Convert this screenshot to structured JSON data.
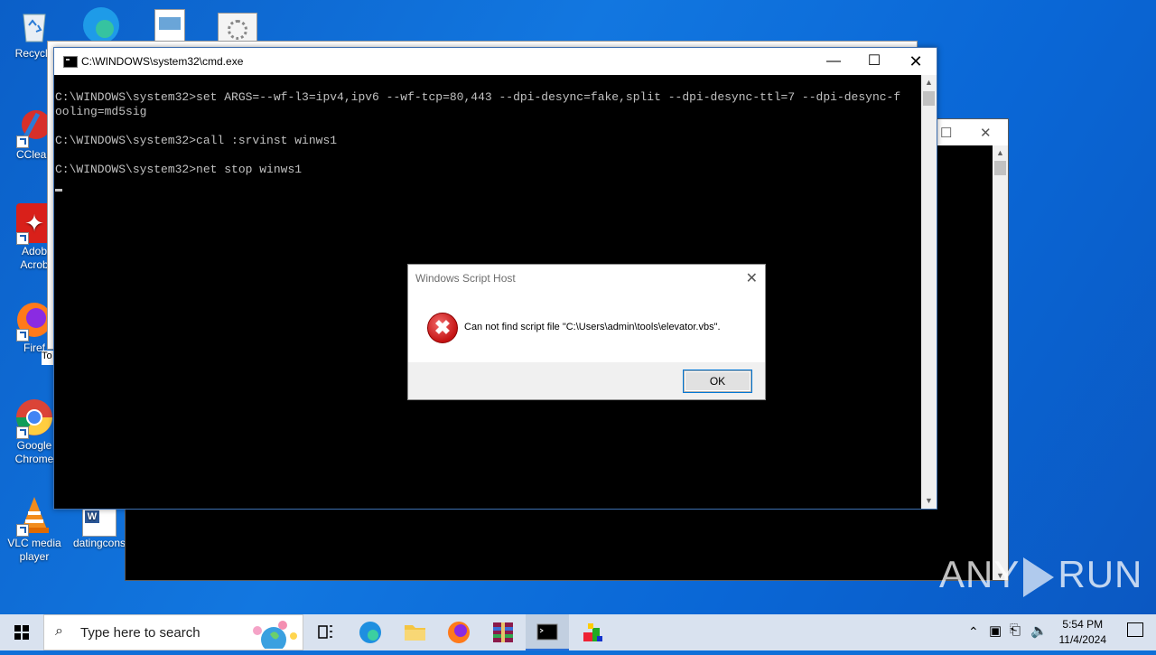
{
  "desktop": {
    "icons": [
      {
        "label": "Recycle"
      },
      {
        "label": "CClean"
      },
      {
        "label": "Adob Acrob"
      },
      {
        "label": "Firef"
      },
      {
        "label": "Google Chrome"
      },
      {
        "label": "VLC media player"
      },
      {
        "label": "datingcons"
      }
    ],
    "behind_label": "To"
  },
  "cmd": {
    "title": "C:\\WINDOWS\\system32\\cmd.exe",
    "lines": [
      "C:\\WINDOWS\\system32>set ARGS=--wf-l3=ipv4,ipv6 --wf-tcp=80,443 --dpi-desync=fake,split --dpi-desync-ttl=7 --dpi-desync-f",
      "ooling=md5sig",
      "",
      "C:\\WINDOWS\\system32>call :srvinst winws1",
      "",
      "C:\\WINDOWS\\system32>net stop winws1"
    ]
  },
  "dialog": {
    "title": "Windows Script Host",
    "message": "Can not find script file \"C:\\Users\\admin\\tools\\elevator.vbs\".",
    "ok_label": "OK"
  },
  "watermark": {
    "left": "ANY",
    "right": "RUN"
  },
  "taskbar": {
    "search_placeholder": "Type here to search",
    "time": "5:54 PM",
    "date": "11/4/2024"
  }
}
